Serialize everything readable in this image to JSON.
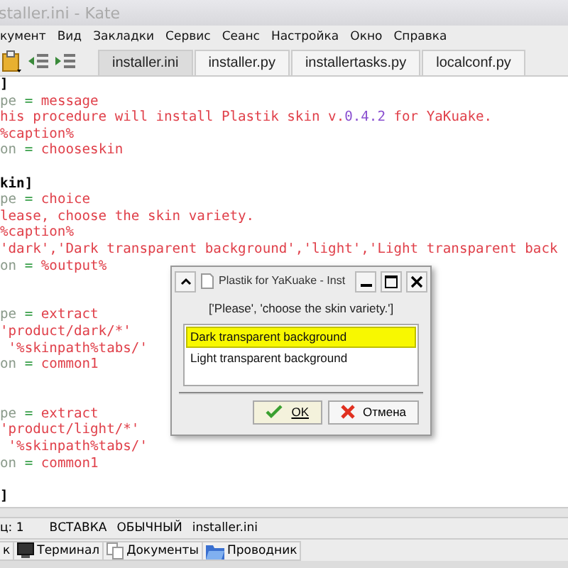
{
  "window": {
    "title": "staller.ini - Kate"
  },
  "menu": [
    "кумент",
    "Вид",
    "Закладки",
    "Сервис",
    "Сеанс",
    "Настройка",
    "Окно",
    "Справка"
  ],
  "tabs": [
    {
      "label": "installer.ini",
      "selected": true
    },
    {
      "label": "installer.py",
      "selected": false
    },
    {
      "label": "installertasks.py",
      "selected": false
    },
    {
      "label": "localconf.py",
      "selected": false
    }
  ],
  "editor": {
    "lines": [
      {
        "kind": "code",
        "segments": [
          {
            "kind": "bracket",
            "text": "]"
          }
        ]
      },
      {
        "kind": "code",
        "segments": [
          {
            "kind": "key",
            "text": "pe"
          },
          {
            "kind": "op",
            "text": " = "
          },
          {
            "kind": "value",
            "text": "message"
          }
        ]
      },
      {
        "kind": "code",
        "segments": [
          {
            "kind": "value",
            "text": "his procedure will install Plastik skin v."
          },
          {
            "kind": "number",
            "text": "0.4.2"
          },
          {
            "kind": "value",
            "text": " for YaKuake."
          }
        ]
      },
      {
        "kind": "code",
        "segments": [
          {
            "kind": "value",
            "text": "%caption%"
          }
        ]
      },
      {
        "kind": "code",
        "segments": [
          {
            "kind": "key",
            "text": "on"
          },
          {
            "kind": "op",
            "text": " = "
          },
          {
            "kind": "value",
            "text": "chooseskin"
          }
        ]
      },
      {
        "kind": "blank"
      },
      {
        "kind": "code",
        "segments": [
          {
            "kind": "bracket",
            "text": "kin]"
          }
        ]
      },
      {
        "kind": "code",
        "segments": [
          {
            "kind": "key",
            "text": "pe"
          },
          {
            "kind": "op",
            "text": " = "
          },
          {
            "kind": "value",
            "text": "choice"
          }
        ]
      },
      {
        "kind": "code",
        "segments": [
          {
            "kind": "value",
            "text": "lease, choose the skin variety."
          }
        ]
      },
      {
        "kind": "code",
        "segments": [
          {
            "kind": "value",
            "text": "%caption%"
          }
        ]
      },
      {
        "kind": "code",
        "segments": [
          {
            "kind": "value",
            "text": "'dark','Dark transparent background','light','Light transparent back"
          }
        ]
      },
      {
        "kind": "code",
        "segments": [
          {
            "kind": "key",
            "text": "on"
          },
          {
            "kind": "op",
            "text": " = "
          },
          {
            "kind": "value",
            "text": "%output%"
          }
        ]
      },
      {
        "kind": "blank"
      },
      {
        "kind": "blank"
      },
      {
        "kind": "code",
        "segments": [
          {
            "kind": "key",
            "text": "pe"
          },
          {
            "kind": "op",
            "text": " = "
          },
          {
            "kind": "value",
            "text": "extract"
          }
        ]
      },
      {
        "kind": "code",
        "segments": [
          {
            "kind": "value",
            "text": "'product/dark/*'"
          }
        ]
      },
      {
        "kind": "code",
        "segments": [
          {
            "kind": "value",
            "text": " '%skinpath%tabs/'"
          }
        ]
      },
      {
        "kind": "code",
        "segments": [
          {
            "kind": "key",
            "text": "on"
          },
          {
            "kind": "op",
            "text": " = "
          },
          {
            "kind": "value",
            "text": "common1"
          }
        ]
      },
      {
        "kind": "blank"
      },
      {
        "kind": "blank"
      },
      {
        "kind": "code",
        "segments": [
          {
            "kind": "key",
            "text": "pe"
          },
          {
            "kind": "op",
            "text": " = "
          },
          {
            "kind": "value",
            "text": "extract"
          }
        ]
      },
      {
        "kind": "code",
        "segments": [
          {
            "kind": "value",
            "text": "'product/light/*'"
          }
        ]
      },
      {
        "kind": "code",
        "segments": [
          {
            "kind": "value",
            "text": " '%skinpath%tabs/'"
          }
        ]
      },
      {
        "kind": "code",
        "segments": [
          {
            "kind": "key",
            "text": "on"
          },
          {
            "kind": "op",
            "text": " = "
          },
          {
            "kind": "value",
            "text": "common1"
          }
        ]
      },
      {
        "kind": "blank"
      },
      {
        "kind": "code",
        "segments": [
          {
            "kind": "bracket",
            "text": "]"
          }
        ]
      }
    ]
  },
  "dialog": {
    "title": "Plastik for YaKuake - Inst",
    "message": "['Please', 'choose the skin variety.']",
    "items": [
      {
        "label": "Dark transparent background",
        "selected": true
      },
      {
        "label": "Light transparent background",
        "selected": false
      }
    ],
    "ok": "OK",
    "cancel": "Отмена"
  },
  "status_bar": [
    "ц: 1",
    "ВСТАВКА",
    "ОБЫЧНЫЙ",
    "installer.ini"
  ],
  "bottom_tabs": [
    "к",
    "Терминал",
    "Документы",
    "Проводник"
  ]
}
